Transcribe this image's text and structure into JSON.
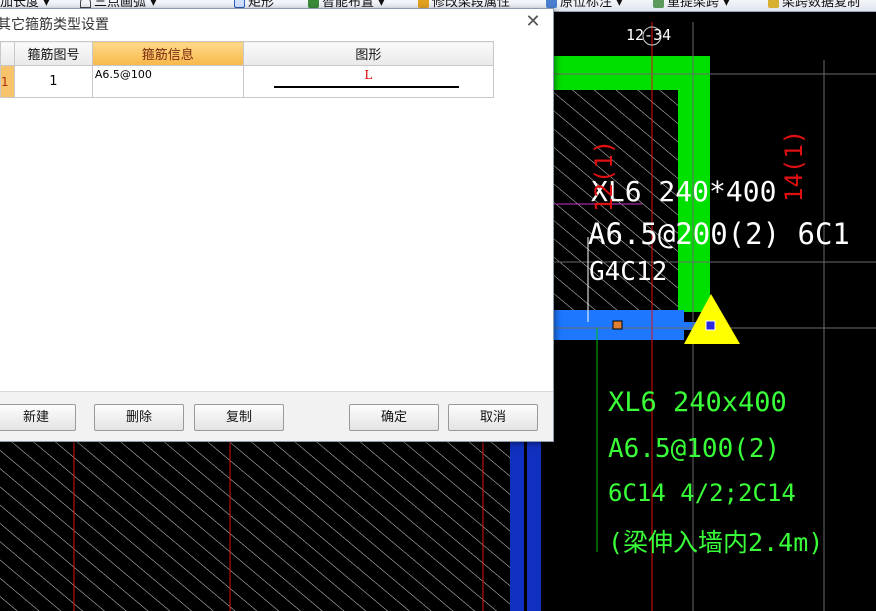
{
  "toolbar": {
    "items": [
      {
        "label": "加长度",
        "icon": "ruler-icon"
      },
      {
        "label": "三点画弧",
        "icon": "arc-icon"
      },
      {
        "label": "矩形",
        "icon": "rectangle-icon"
      },
      {
        "label": "智能布置",
        "icon": "smart-layout-icon"
      },
      {
        "label": "修改梁段属性",
        "icon": "edit-beam-icon"
      },
      {
        "label": "原位标注",
        "icon": "annotate-icon"
      },
      {
        "label": "重提梁跨",
        "icon": "beam-span-icon"
      },
      {
        "label": "梁跨数据复制",
        "icon": "copy-data-icon"
      }
    ]
  },
  "dialog": {
    "title": "其它箍筋类型设置",
    "close_icon": "close-icon",
    "columns": [
      "",
      "箍筋图号",
      "箍筋信息",
      "图形"
    ],
    "rows": [
      {
        "index": "1",
        "figure_no": "1",
        "info": "A6.5@100",
        "shape_label": "L"
      }
    ],
    "buttons": {
      "new": "新建",
      "delete": "删除",
      "copy": "复制",
      "ok": "确定",
      "cancel": "取消"
    }
  },
  "cad": {
    "axis_label": "12-34",
    "upper_annotation": [
      "XL6 240*400",
      "A6.5@200(2) 6C1",
      "G4C12"
    ],
    "vertical_labels": [
      "12(1)",
      "14(1)"
    ],
    "lower_annotation": [
      "XL6 240x400",
      "A6.5@100(2)",
      "6C14 4/2;2C14",
      "(梁伸入墙内2.4m)"
    ],
    "colors": {
      "green": "#00e000",
      "annotation_white": "#ffffff",
      "annotation_green": "#39ff39",
      "red_line": "#e01010",
      "blue_beam": "#1e78ff",
      "yellow_marker": "#ffff00",
      "magenta": "#cc33cc"
    }
  }
}
